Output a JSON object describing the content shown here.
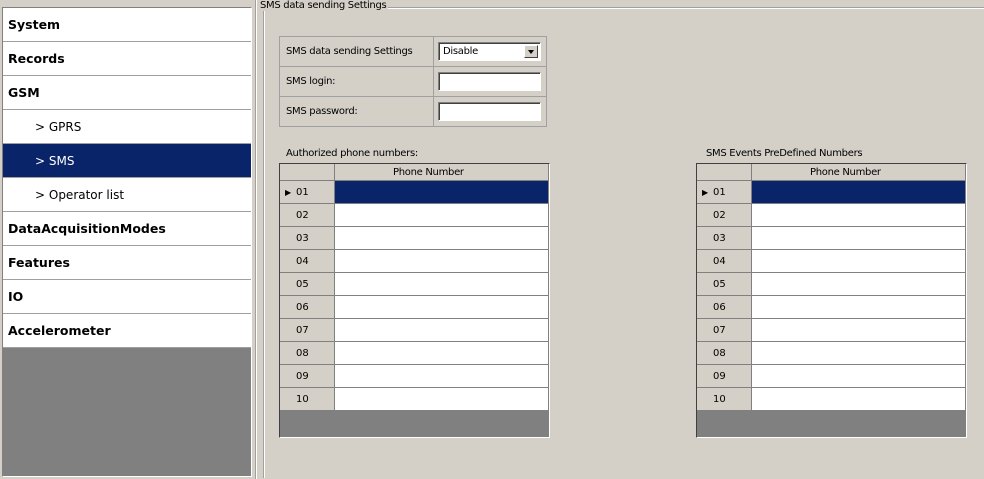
{
  "nav": {
    "items": [
      {
        "label": "System"
      },
      {
        "label": "Records"
      },
      {
        "label": "GSM"
      },
      {
        "label": "> GPRS"
      },
      {
        "label": "> SMS"
      },
      {
        "label": "> Operator list"
      },
      {
        "label": "DataAcquisitionModes"
      },
      {
        "label": "Features"
      },
      {
        "label": "IO"
      },
      {
        "label": "Accelerometer"
      }
    ],
    "selected": "> SMS"
  },
  "group": {
    "title": "SMS data sending Settings"
  },
  "settings": {
    "sending_label": "SMS data sending Settings",
    "sending_value": "Disable",
    "login_label": "SMS login:",
    "login_value": "",
    "password_label": "SMS password:",
    "password_value": ""
  },
  "authorized": {
    "label": "Authorized phone numbers:",
    "column": "Phone Number",
    "rows": [
      "01",
      "02",
      "03",
      "04",
      "05",
      "06",
      "07",
      "08",
      "09",
      "10"
    ],
    "values": [
      "",
      "",
      "",
      "",
      "",
      "",
      "",
      "",
      "",
      ""
    ]
  },
  "predefined": {
    "label": "SMS Events PreDefined Numbers",
    "column": "Phone Number",
    "rows": [
      "01",
      "02",
      "03",
      "04",
      "05",
      "06",
      "07",
      "08",
      "09",
      "10"
    ],
    "values": [
      "",
      "",
      "",
      "",
      "",
      "",
      "",
      "",
      "",
      ""
    ]
  },
  "colors": {
    "selection": "#0a246a",
    "face": "#d4d0c8"
  }
}
